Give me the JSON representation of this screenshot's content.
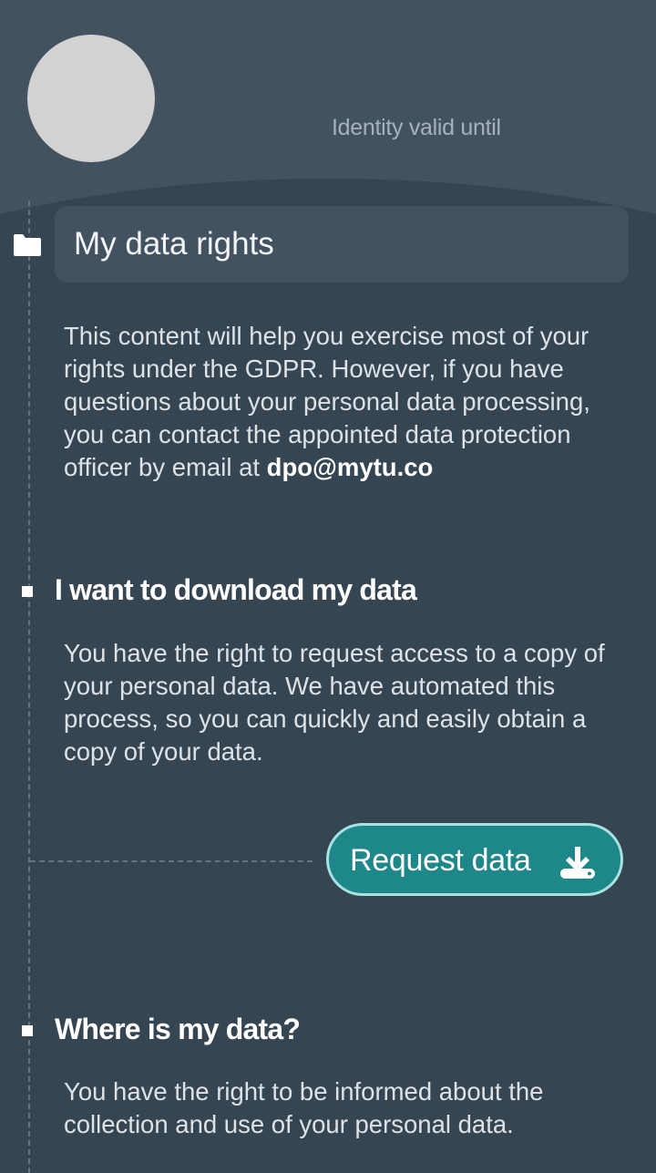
{
  "header": {
    "identity_label": "Identity valid until"
  },
  "page": {
    "title": "My data rights",
    "intro_text": "This content will help you exercise most of your rights under the GDPR. However, if you have questions about your personal data processing, you can contact the appointed data protection officer by email at",
    "dpo_email": "dpo@mytu.co"
  },
  "sections": [
    {
      "title": "I want to download my data",
      "body": "You have the right to request access to a copy of your personal data. We have automated this process, so you can quickly and easily obtain a copy of your data.",
      "button_label": "Request data",
      "button_icon": "download-icon"
    },
    {
      "title": "Where is my data?",
      "body": "You have the right to be informed about the collection and use of your personal data."
    }
  ],
  "colors": {
    "background": "#364552",
    "header": "#435260",
    "button": "#1e8789",
    "button_border": "#a8e3e1"
  }
}
